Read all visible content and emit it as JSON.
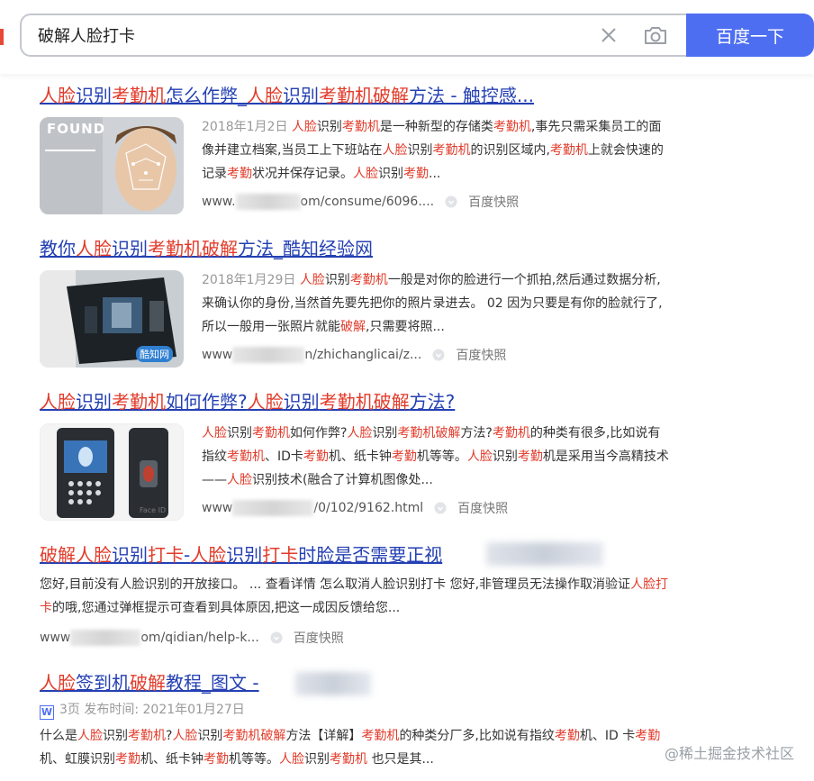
{
  "search": {
    "query": "破解人脸打卡",
    "button_label": "百度一下"
  },
  "results": [
    {
      "title_parts": [
        "人脸",
        "识别",
        "考勤机",
        "怎么作弊_",
        "人脸",
        "识别",
        "考勤机",
        "破解",
        "方法 - 触控感..."
      ],
      "date": "2018年1月2日",
      "snippet_parts": [
        " ",
        "人脸",
        "识别",
        "考勤机",
        "是一种新型的存储类",
        "考勤机",
        ",事先只需采集员工的面像并建立档案,当员工上下班站在",
        "人脸",
        "识别",
        "考勤机",
        "的识别区域内,",
        "考勤机",
        "上就会快速的记录",
        "考勤",
        "状况并保存记录。",
        "人脸",
        "识别",
        "考勤",
        "..."
      ],
      "url_prefix": "www.",
      "url_suffix": "om/consume/6096....",
      "snapshot": "百度快照",
      "thumb_label": "FOUND"
    },
    {
      "title_parts": [
        "教你",
        "人脸",
        "识别",
        "考勤机",
        "破解",
        "方法_酷知经验网"
      ],
      "date": "2018年1月29日",
      "snippet_parts": [
        " ",
        "人脸",
        "识别",
        "考勤机",
        "一般是对你的脸进行一个抓拍,然后通过数据分析,来确认你的身份,当然首先要先把你的照片录进去。 02 因为只要是有你的脸就行了,所以一般用一张照片就能",
        "破解",
        ",只需要将照..."
      ],
      "url_prefix": "www",
      "url_suffix": "n/zhichanglicai/z...",
      "snapshot": "百度快照",
      "thumb_label": "酷知网"
    },
    {
      "title_parts": [
        "人脸",
        "识别",
        "考勤机",
        "如何作弊?",
        "人脸",
        "识别",
        "考勤机",
        "破解",
        "方法?"
      ],
      "snippet_parts": [
        "人脸",
        "识别",
        "考勤机",
        "如何作弊?",
        "人脸",
        "识别",
        "考勤机",
        "破解",
        "方法?",
        "考勤机",
        "的种类有很多,比如说有指纹",
        "考勤机",
        "、ID卡",
        "考勤",
        "机、纸卡钟",
        "考勤",
        "机等等。",
        "人脸",
        "识别",
        "考勤",
        "机是采用当今高精技术——",
        "人脸",
        "识别技术(融合了计算机图像处..."
      ],
      "url_prefix": "www",
      "url_suffix": "/0/102/9162.html",
      "snapshot": "百度快照",
      "thumb_label": "Face ID"
    },
    {
      "title_parts": [
        "破解",
        "人脸",
        "识别",
        "打卡",
        "-",
        "人脸",
        "识别",
        "打卡",
        "时脸是否需要正视"
      ],
      "snippet_parts": [
        "您好,目前没有人脸识别的开放接口。 ... 查看详情 怎么取消人脸识别打卡 您好,非管理员无法操作取消验证",
        "人脸打卡",
        "的哦,您通过弹框提示可查看到具体原因,把这一成因反馈给您..."
      ],
      "url_prefix": "www",
      "url_suffix": "om/qidian/help-k...",
      "snapshot": "百度快照"
    },
    {
      "title_parts": [
        "人脸",
        "签到机",
        "破解",
        "教程_图文 - "
      ],
      "doc_icon": "W",
      "meta": "3页 发布时间: 2021年01月27日",
      "snippet_parts": [
        "什么是",
        "人脸",
        "识别",
        "考勤机",
        "?",
        "人脸",
        "识别",
        "考勤机",
        "破解",
        "方法【详解】",
        "考勤机",
        "的种类分厂多,比如说有指纹",
        "考勤",
        "机、ID 卡",
        "考勤",
        " 机、虹膜识别",
        "考勤",
        "机、纸卡钟",
        "考勤",
        "机等等。",
        "人脸",
        "识别",
        "考勤机",
        " 也只是其..."
      ]
    }
  ],
  "watermark": "@稀土掘金技术社区"
}
